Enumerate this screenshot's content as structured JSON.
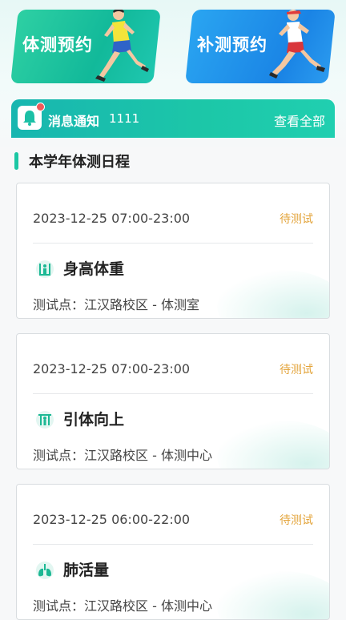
{
  "banners": {
    "left_label": "体测预约",
    "right_label": "补测预约"
  },
  "notice": {
    "title": "消息通知",
    "count": "1111",
    "view_all": "查看全部"
  },
  "section": {
    "title": "本学年体测日程"
  },
  "cards": [
    {
      "time": "2023-12-25 07:00-23:00",
      "status": "待测试",
      "name": "身高体重",
      "location": "测试点：江汉路校区 - 体测室",
      "icon": "height-weight-icon"
    },
    {
      "time": "2023-12-25 07:00-23:00",
      "status": "待测试",
      "name": "引体向上",
      "location": "测试点：江汉路校区 - 体测中心",
      "icon": "pull-up-icon"
    },
    {
      "time": "2023-12-25 06:00-22:00",
      "status": "待测试",
      "name": "肺活量",
      "location": "测试点：江汉路校区 - 体测中心",
      "icon": "lungs-icon"
    }
  ],
  "colors": {
    "accent": "#1cc7a4",
    "status": "#e3a43b",
    "notice_red": "#f05a5a"
  }
}
